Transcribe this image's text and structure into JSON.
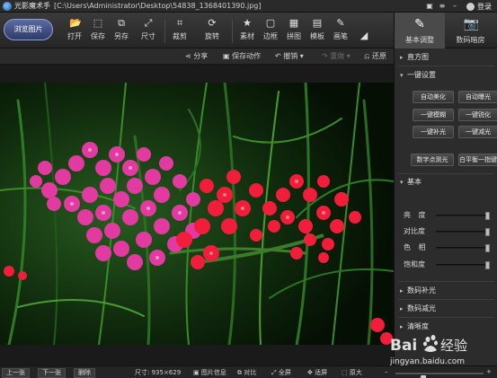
{
  "window": {
    "title": "光影魔术手",
    "path": "[C:\\Users\\Administrator\\Desktop\\54838_1368401390.jpg]",
    "login": "登录"
  },
  "toolbar": {
    "browse": "浏览图片",
    "tools": [
      {
        "label": "打开",
        "icon": "folder-icon"
      },
      {
        "label": "保存",
        "icon": "save-icon"
      },
      {
        "label": "另存",
        "icon": "save-as-icon"
      },
      {
        "label": "尺寸",
        "icon": "resize-icon"
      },
      {
        "label": "裁剪",
        "icon": "crop-icon"
      },
      {
        "label": "旋转",
        "icon": "rotate-icon"
      },
      {
        "label": "素材",
        "icon": "material-icon"
      },
      {
        "label": "边框",
        "icon": "frame-icon"
      },
      {
        "label": "拼图",
        "icon": "collage-icon"
      },
      {
        "label": "模板",
        "icon": "template-icon"
      },
      {
        "label": "画笔",
        "icon": "brush-icon"
      }
    ],
    "right_tabs": [
      {
        "label": "基本调整",
        "icon": "adjust-icon",
        "active": true
      },
      {
        "label": "数码暗房",
        "icon": "camera-icon",
        "active": false
      }
    ]
  },
  "actionbar": {
    "share": "分享",
    "save_action": "保存动作",
    "undo": "撤销",
    "redo": "重做",
    "restore": "还原"
  },
  "panel": {
    "histogram": "直方图",
    "one_click": "一键设置",
    "buttons": [
      "自动美化",
      "自动曝光",
      "一键模糊",
      "一键锐化",
      "一键补光",
      "一键减光",
      "数字点测光",
      "白平衡一指键"
    ],
    "basic": "基本",
    "sliders": [
      {
        "label": "亮 度",
        "value": 1.0
      },
      {
        "label": "对比度",
        "value": 1.0
      },
      {
        "label": "色 相",
        "value": 1.0
      },
      {
        "label": "饱和度",
        "value": 1.0
      }
    ],
    "collapsed": [
      "数码补光",
      "数码减光",
      "清晰度"
    ]
  },
  "statusbar": {
    "prev": "上一张",
    "next": "下一张",
    "delete": "删除",
    "size": "尺寸: 935×629",
    "info": "图片信息",
    "compare": "对比",
    "fullscreen": "全屏",
    "fit": "适屏",
    "original": "原大",
    "zoom_level": 0.3
  },
  "watermark": {
    "text": "Baidu 经验",
    "url": "jingyan.baidu.com"
  },
  "colors": {
    "accent": "#4a6ab0",
    "flower_pink": "#e23aa0",
    "flower_red": "#f21d3a",
    "foliage": "#1f5a1c"
  }
}
